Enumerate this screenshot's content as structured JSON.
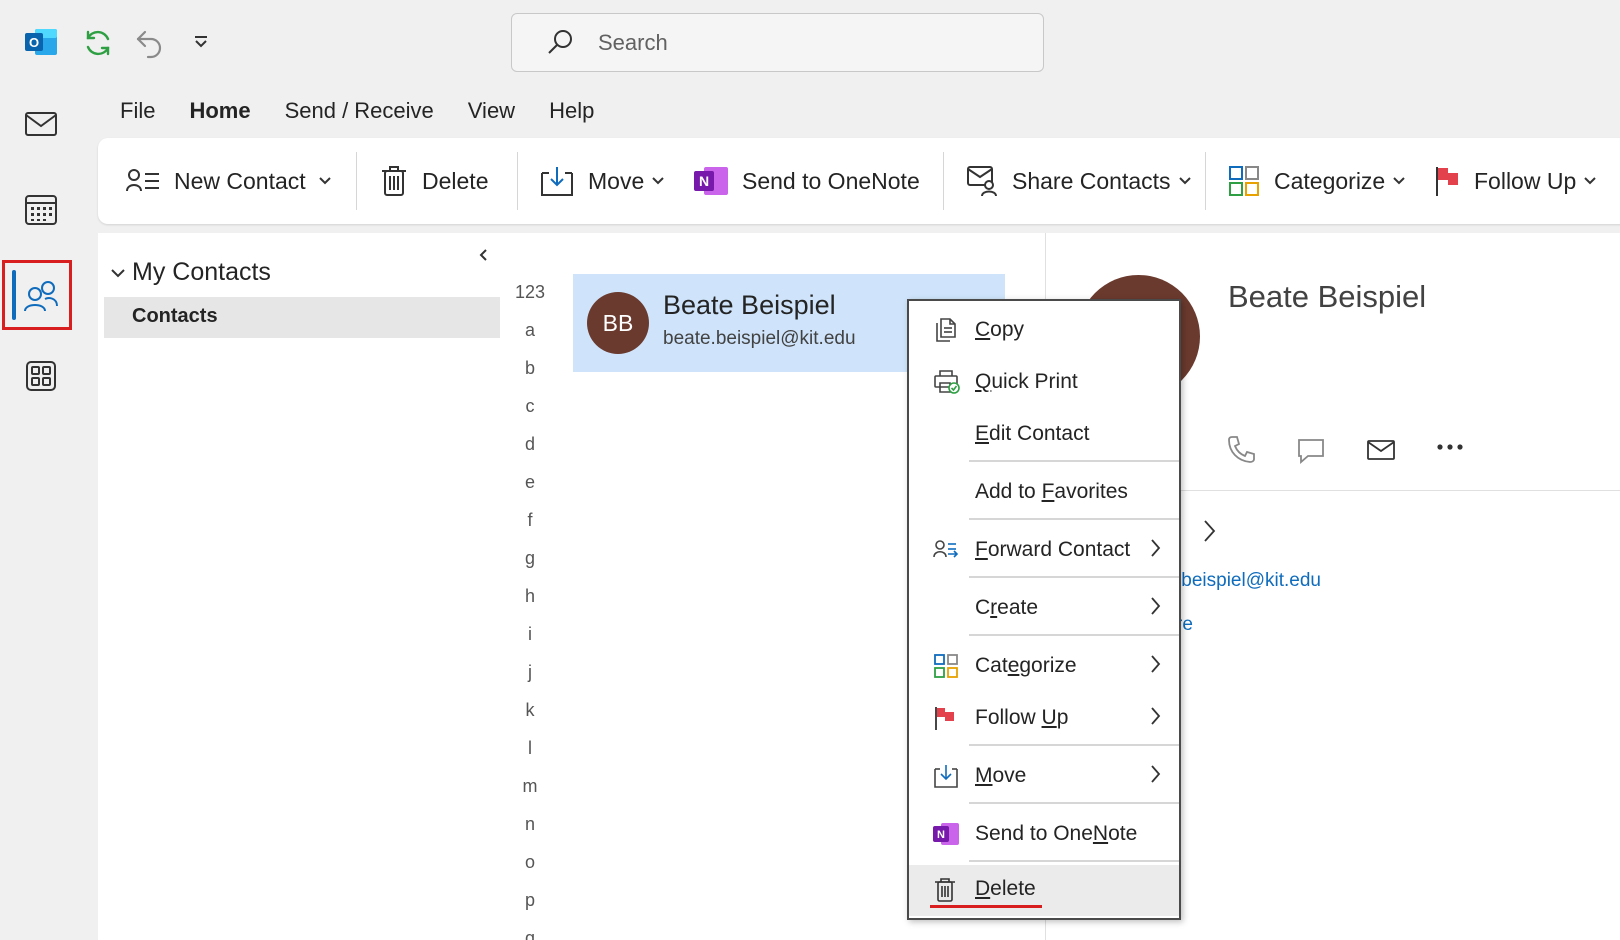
{
  "titlebar": {
    "search_placeholder": "Search",
    "icons": [
      "outlook-logo-icon",
      "sync-icon",
      "undo-icon",
      "customize-toolbar-icon"
    ]
  },
  "rail": {
    "items": [
      "mail-icon",
      "calendar-icon",
      "people-icon",
      "apps-icon"
    ],
    "active": "people-icon",
    "highlight_color": "#d81e1e"
  },
  "tabs": [
    {
      "label": "File"
    },
    {
      "label": "Home",
      "active": true
    },
    {
      "label": "Send / Receive"
    },
    {
      "label": "View"
    },
    {
      "label": "Help"
    }
  ],
  "ribbon": {
    "new_contact": "New Contact",
    "delete": "Delete",
    "move": "Move",
    "send_to_onenote": "Send to OneNote",
    "share_contacts": "Share Contacts",
    "categorize": "Categorize",
    "follow_up": "Follow Up"
  },
  "folders": {
    "group": "My Contacts",
    "selected": "Contacts"
  },
  "letters": [
    "123",
    "a",
    "b",
    "c",
    "d",
    "e",
    "f",
    "g",
    "h",
    "i",
    "j",
    "k",
    "l",
    "m",
    "n",
    "o",
    "p",
    "q"
  ],
  "contact": {
    "initials": "BB",
    "name": "Beate Beispiel",
    "email": "beate.beispiel@kit.edu",
    "avatar_color": "#6b3a2e"
  },
  "reading_pane": {
    "name": "Beate Beispiel",
    "email_partial": ".beispiel@kit.edu",
    "more_partial": "re",
    "actions": [
      "phone-icon",
      "chat-icon",
      "mail-icon",
      "more-icon"
    ]
  },
  "context_menu": {
    "items": [
      {
        "pre": "",
        "ul": "C",
        "post": "opy",
        "icon": "copy-icon"
      },
      {
        "pre": "",
        "ul": "Q",
        "post": "uick Print",
        "icon": "quick-print-icon"
      },
      {
        "pre": "",
        "ul": "E",
        "post": "dit Contact",
        "icon": ""
      },
      {
        "pre": "Add to ",
        "ul": "F",
        "post": "avorites",
        "icon": ""
      },
      {
        "pre": "",
        "ul": "F",
        "post": "orward Contact",
        "icon": "forward-contact-icon",
        "submenu": true
      },
      {
        "pre": "C",
        "ul": "r",
        "post": "eate",
        "icon": "",
        "submenu": true
      },
      {
        "pre": "Cat",
        "ul": "e",
        "post": "gorize",
        "icon": "categorize-icon",
        "submenu": true
      },
      {
        "pre": "Follow ",
        "ul": "U",
        "post": "p",
        "icon": "flag-icon",
        "submenu": true
      },
      {
        "pre": "",
        "ul": "M",
        "post": "ove",
        "icon": "move-icon",
        "submenu": true
      },
      {
        "pre": "Send to One",
        "ul": "N",
        "post": "ote",
        "icon": "onenote-icon"
      },
      {
        "pre": "",
        "ul": "D",
        "post": "elete",
        "icon": "delete-icon",
        "hover": true
      }
    ]
  }
}
